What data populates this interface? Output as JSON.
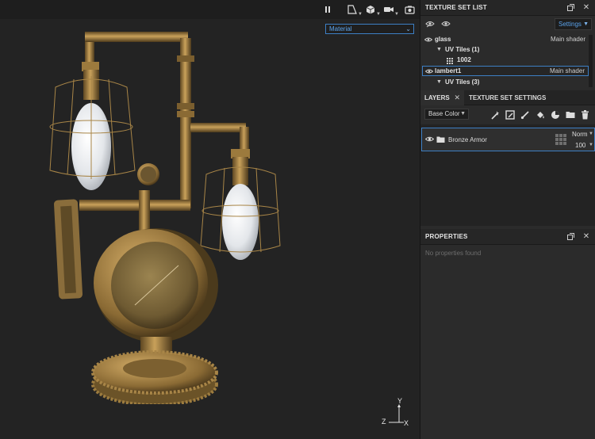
{
  "viewport": {
    "material_select": {
      "value": "Material"
    },
    "toolbar_icons": [
      "pause-icon",
      "camera-projection-icon",
      "cube-icon",
      "video-camera-icon",
      "screenshot-icon"
    ],
    "axis_labels": {
      "x": "X",
      "y": "Y",
      "z": "Z"
    }
  },
  "texture_set_list": {
    "title": "TEXTURE SET LIST",
    "settings_label": "Settings",
    "items": [
      {
        "name": "glass",
        "shader": "Main shader"
      },
      {
        "name": "UV Tiles (1)"
      },
      {
        "name": "1002"
      },
      {
        "name": "lambert1",
        "shader": "Main shader",
        "selected": true
      },
      {
        "name": "UV Tiles (3)"
      }
    ]
  },
  "layers": {
    "tabs": [
      {
        "label": "LAYERS",
        "active": true
      },
      {
        "label": "TEXTURE SET SETTINGS",
        "active": false
      }
    ],
    "channel": "Base Color",
    "items": [
      {
        "name": "Bronze Armor",
        "blend_mode": "Norm",
        "opacity": "100"
      }
    ]
  },
  "properties": {
    "title": "PROPERTIES",
    "empty_message": "No properties found"
  },
  "colors": {
    "accent": "#3d7fc4",
    "accent_text": "#5aa2ea",
    "panel_bg": "#2b2b2b",
    "viewport_bg": "#232323",
    "brass": "#b08a4a"
  }
}
